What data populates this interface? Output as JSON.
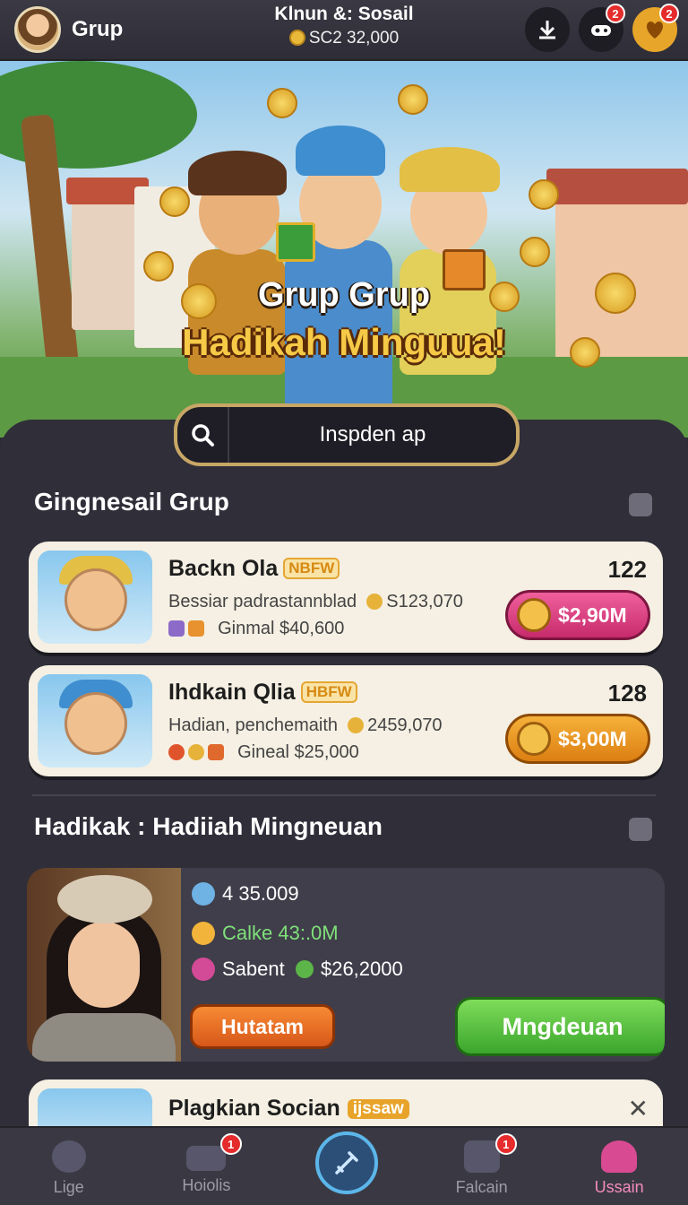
{
  "topbar": {
    "group_label": "Grup",
    "title": "Klnun &: Sosail",
    "coins": "SC2 32,000",
    "icons": [
      "download-icon",
      "controller-icon",
      "heart-gift-icon"
    ],
    "badges": [
      "2",
      "2"
    ]
  },
  "banner": {
    "title_line1": "Grup Grup",
    "title_line2": "Hadikah Minguua!"
  },
  "search": {
    "placeholder": "Inspden ap"
  },
  "section1": {
    "title": "Gingnesail Grup"
  },
  "cards": [
    {
      "name": "Backn Ola",
      "tag": "NBFW",
      "desc": "Bessiar padrastannblad",
      "desc_value": "S123,070",
      "desc2": "Ginmal $40,600",
      "number": "122",
      "pill": "$2,90M",
      "pill_color": "#d94388"
    },
    {
      "name": "Ihdkain Qlia",
      "tag": "HBFW",
      "desc": "Hadian, penchemaith",
      "desc_value": "2459,070",
      "desc2": "Gineal $25,000",
      "number": "128",
      "pill": "$3,00M",
      "pill_color": "#ea9a24"
    }
  ],
  "section2": {
    "title": "Hadikak : Hadiiah Mingneuan"
  },
  "weekly": {
    "row1": "4 35.009",
    "row2": "Calke 43:.0M",
    "row3_label": "Sabent",
    "row3_value": "$26,2000",
    "button_secondary": "Hutatam",
    "button_primary": "Mngdeuan"
  },
  "card3": {
    "name": "Plagkian Socian",
    "tag": "ijssaw"
  },
  "bottomnav": {
    "items": [
      {
        "label": "Lige",
        "badge": ""
      },
      {
        "label": "Hoiolis",
        "badge": "1"
      },
      {
        "label": "",
        "badge": ""
      },
      {
        "label": "Falcain",
        "badge": "1"
      },
      {
        "label": "Ussain",
        "badge": ""
      }
    ]
  },
  "colors": {
    "background": "#2d2c36",
    "accent_pink": "#d84a92",
    "accent_green": "#3aa62c",
    "accent_orange": "#dc7f12",
    "gold": "#e9b93a"
  }
}
